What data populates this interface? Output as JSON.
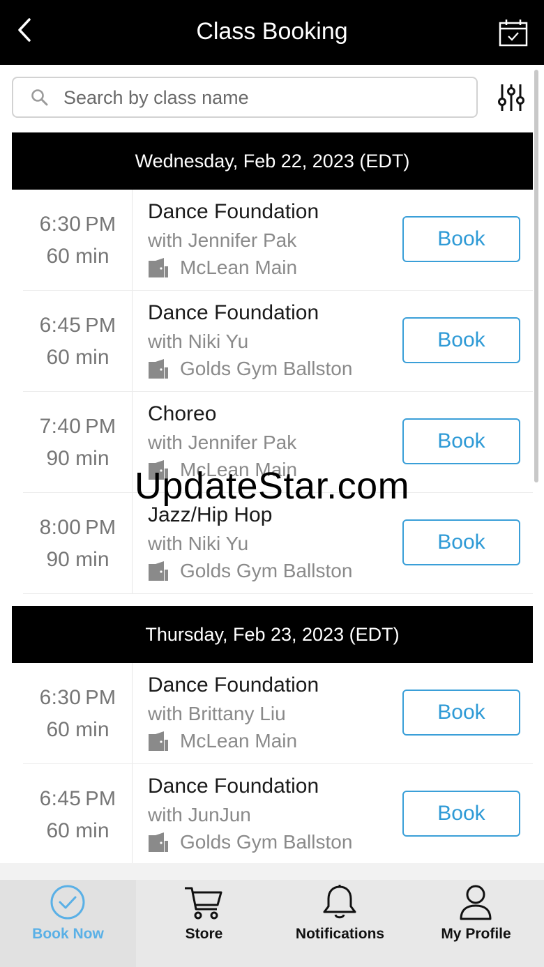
{
  "header": {
    "title": "Class Booking",
    "back_icon": "chevron-left-icon",
    "calendar_icon": "calendar-check-icon"
  },
  "search": {
    "placeholder": "Search by class name",
    "value": "",
    "filter_icon": "sliders-icon"
  },
  "days": [
    {
      "date_label": "Wednesday, Feb 22, 2023 (EDT)",
      "classes": [
        {
          "time": "6:30",
          "ampm": "PM",
          "duration": "60 min",
          "name": "Dance Foundation",
          "instructor": "with Jennifer Pak",
          "location": "McLean Main",
          "action": "Book"
        },
        {
          "time": "6:45",
          "ampm": "PM",
          "duration": "60 min",
          "name": "Dance Foundation",
          "instructor": "with Niki Yu",
          "location": "Golds Gym Ballston",
          "action": "Book"
        },
        {
          "time": "7:40",
          "ampm": "PM",
          "duration": "90 min",
          "name": "Choreo",
          "instructor": "with Jennifer Pak",
          "location": "McLean Main",
          "action": "Book"
        },
        {
          "time": "8:00",
          "ampm": "PM",
          "duration": "90 min",
          "name": "Jazz/Hip Hop",
          "instructor": "with Niki Yu",
          "location": "Golds Gym Ballston",
          "action": "Book"
        }
      ]
    },
    {
      "date_label": "Thursday, Feb 23, 2023 (EDT)",
      "classes": [
        {
          "time": "6:30",
          "ampm": "PM",
          "duration": "60 min",
          "name": "Dance Foundation",
          "instructor": "with Brittany Liu",
          "location": "McLean Main",
          "action": "Book"
        },
        {
          "time": "6:45",
          "ampm": "PM",
          "duration": "60 min",
          "name": "Dance Foundation",
          "instructor": "with JunJun",
          "location": "Golds Gym Ballston",
          "action": "Book"
        }
      ]
    }
  ],
  "watermark": "UpdateStar.com",
  "tabs": [
    {
      "label": "Book Now",
      "icon": "check-circle-icon",
      "active": true
    },
    {
      "label": "Store",
      "icon": "cart-icon",
      "active": false
    },
    {
      "label": "Notifications",
      "icon": "bell-icon",
      "active": false
    },
    {
      "label": "My Profile",
      "icon": "user-icon",
      "active": false
    }
  ],
  "colors": {
    "header_bg": "#000000",
    "accent": "#2e9ad6",
    "tab_active": "#5ab0e6",
    "muted_text": "#767676"
  }
}
